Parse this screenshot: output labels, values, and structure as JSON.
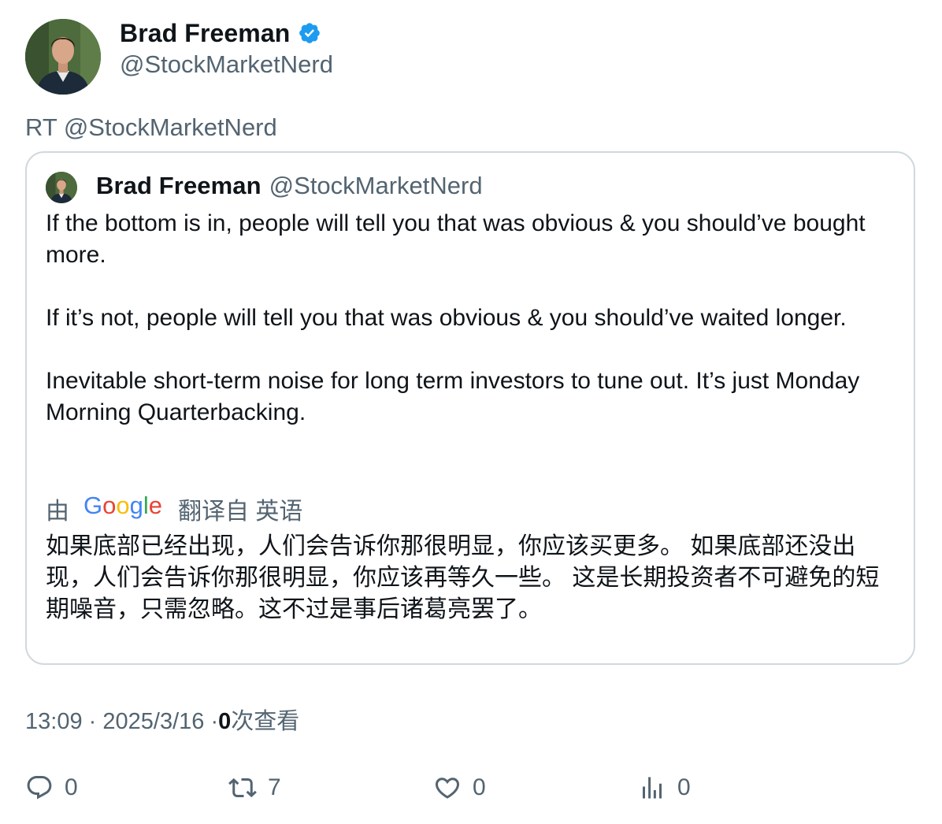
{
  "author": {
    "display_name": "Brad Freeman",
    "handle": "@StockMarketNerd",
    "verified": true
  },
  "retweet_line": "RT @StockMarketNerd",
  "quoted_tweet": {
    "display_name": "Brad Freeman",
    "handle": "@StockMarketNerd",
    "text": "If the bottom is in, people will tell you that was obvious & you should’ve bought more.\n\nIf it’s not, people will tell you that was obvious & you should’ve waited longer.\n\nInevitable short-term noise for long term investors to tune out. It’s just Monday Morning Quarterbacking.",
    "translation": {
      "prefix": "由",
      "provider_logo": "Google",
      "suffix": "翻译自 英语",
      "text": "如果底部已经出现，人们会告诉你那很明显，你应该买更多。 如果底部还没出现，人们会告诉你那很明显，你应该再等久一些。 这是长期投资者不可避免的短期噪音，只需忽略。这不过是事后诸葛亮罢了。"
    }
  },
  "meta": {
    "time": "13:09",
    "separator": "·",
    "date": "2025/3/16",
    "views_count": "0",
    "views_label": "次查看"
  },
  "actions": {
    "replies": "0",
    "retweets": "7",
    "likes": "0",
    "views": "0"
  },
  "colors": {
    "text_primary": "#0f1419",
    "text_secondary": "#536471",
    "border": "#cfd9de",
    "verified_badge": "#1d9bf0"
  },
  "icons": [
    "verified-badge-icon",
    "reply-icon",
    "retweet-icon",
    "like-icon",
    "views-icon"
  ]
}
